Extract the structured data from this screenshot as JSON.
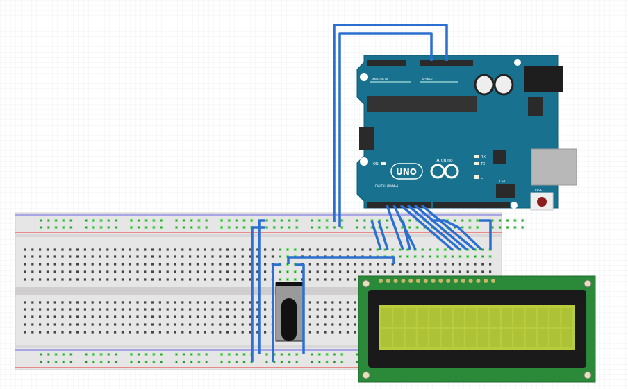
{
  "arduino": {
    "model": "UNO",
    "brand": "Arduino",
    "reset_label": "RESET",
    "icsp_label": "ICSP",
    "tx_label": "TX",
    "rx_label": "RX",
    "l_label": "L",
    "on_label": "ON",
    "digital_label": "DIGITAL (PWM~)",
    "power_label": "POWER",
    "analog_label": "ANALOG IN"
  },
  "colors": {
    "wire": "#2b6fd1",
    "arduino_board": "#17718f",
    "lcd_board": "#2a8a3a",
    "lcd_screen": "#b8cc3c",
    "breadboard": "#e6e6e6"
  }
}
